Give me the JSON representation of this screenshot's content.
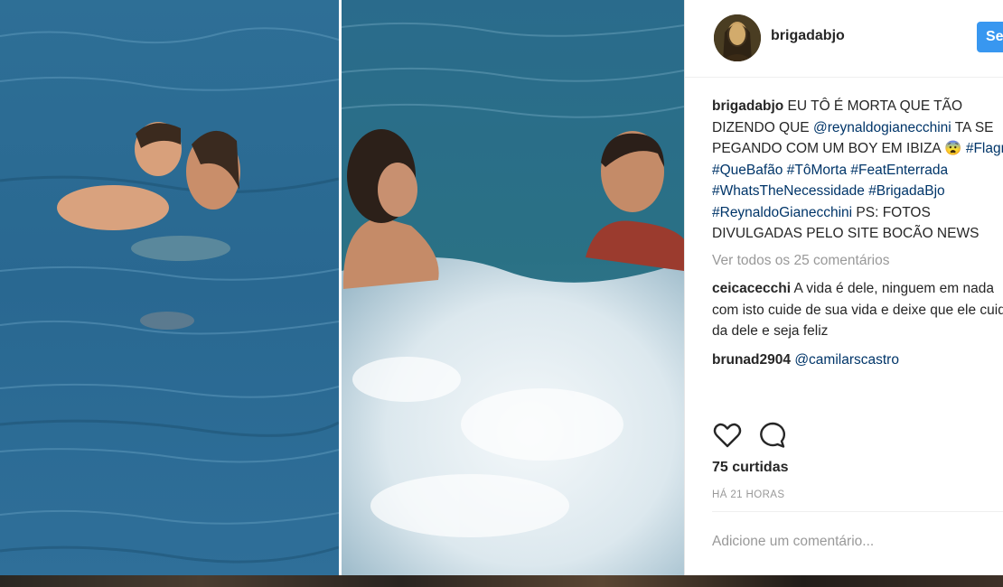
{
  "post": {
    "username": "brigadabjo",
    "follow_label": "Se",
    "caption": {
      "author": "brigadabjo",
      "text_1": " EU TÔ É MORTA QUE TÃO DIZENDO QUE ",
      "mention": "@reynaldogianecchini",
      "text_2": " TA SE PEGANDO COM UM BOY EM IBIZA 😨 ",
      "hashtags": [
        "#Flagra",
        "#QueBafão",
        "#TôMorta",
        "#FeatEnterrada",
        "#WhatsTheNecessidade",
        "#BrigadaBjo",
        "#ReynaldoGianecchini"
      ],
      "text_3": " PS: FOTOS DIVULGADAS PELO SITE BOCÃO NEWS"
    },
    "view_all": "Ver todos os 25 comentários",
    "comments": [
      {
        "user": "ceicacecchi",
        "text": " A vida é dele, ninguem em nada com isto cuide de sua vida e deixe que ele cuida da dele e seja feliz"
      },
      {
        "user": "brunad2904",
        "mention": " @camilarscastro"
      }
    ],
    "likes": "75 curtidas",
    "time": "HÁ 21 HORAS",
    "add_comment_placeholder": "Adicione um comentário...",
    "icons": {
      "like": "heart-icon",
      "comment": "comment-icon"
    },
    "colors": {
      "follow": "#3897f0",
      "link": "#003569",
      "muted": "#999999"
    }
  }
}
